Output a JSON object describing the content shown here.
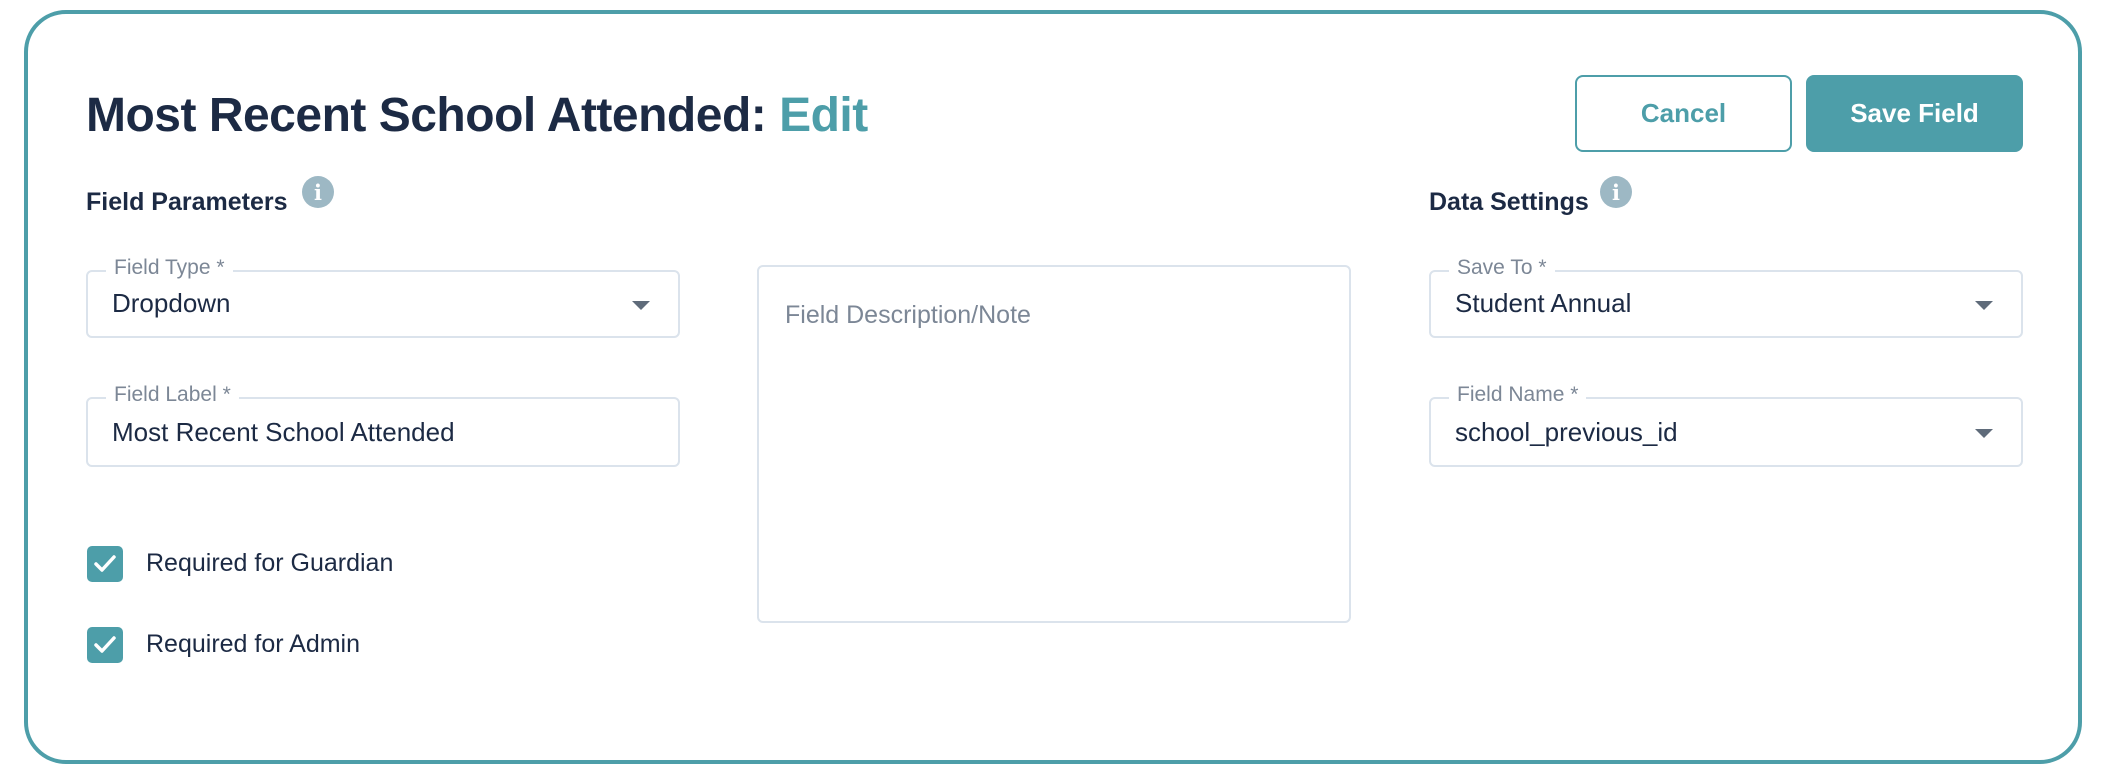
{
  "header": {
    "title_main": "Most Recent School Attended: ",
    "title_accent": "Edit",
    "cancel_label": "Cancel",
    "save_label": "Save Field"
  },
  "field_parameters": {
    "heading": "Field Parameters",
    "info_icon": "info-icon",
    "field_type": {
      "label": "Field Type *",
      "value": "Dropdown"
    },
    "field_label": {
      "label": "Field Label *",
      "value": "Most Recent School Attended"
    },
    "checkboxes": [
      {
        "label": "Required for Guardian",
        "checked": true
      },
      {
        "label": "Required for Admin",
        "checked": true
      }
    ]
  },
  "description": {
    "placeholder": "Field Description/Note"
  },
  "data_settings": {
    "heading": "Data Settings",
    "info_icon": "info-icon",
    "save_to": {
      "label": "Save To *",
      "value": "Student Annual"
    },
    "field_name": {
      "label": "Field Name *",
      "value": "school_previous_id"
    }
  },
  "colors": {
    "accent": "#4d9ea9",
    "text": "#1c2a44",
    "border": "#dbe3ec"
  }
}
